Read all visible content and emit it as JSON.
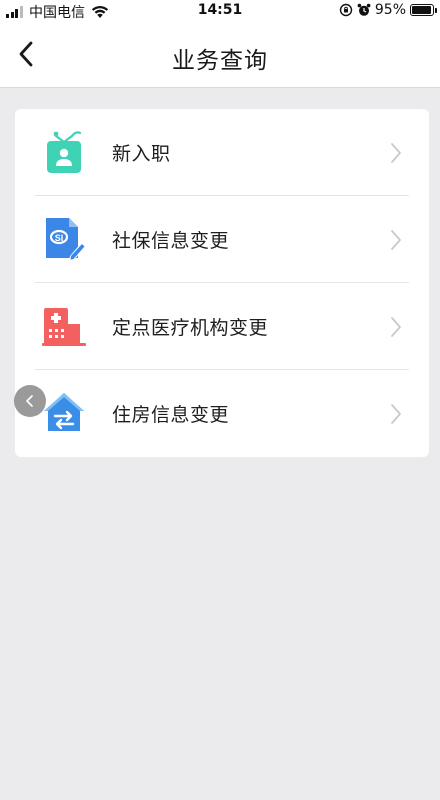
{
  "status_bar": {
    "carrier": "中国电信",
    "time": "14:51",
    "battery_percent": "95%",
    "battery_level": 0.95
  },
  "nav": {
    "title": "业务查询"
  },
  "menu": {
    "items": [
      {
        "label": "新入职",
        "icon": "badge-icon"
      },
      {
        "label": "社保信息变更",
        "icon": "document-edit-icon"
      },
      {
        "label": "定点医疗机构变更",
        "icon": "hospital-icon"
      },
      {
        "label": "住房信息变更",
        "icon": "house-exchange-icon"
      }
    ]
  },
  "colors": {
    "background": "#ebebed",
    "badge_icon": "#3fd2b5",
    "document_icon": "#3b86e6",
    "hospital_icon": "#f26160",
    "house_icon": "#3a8ee8"
  }
}
